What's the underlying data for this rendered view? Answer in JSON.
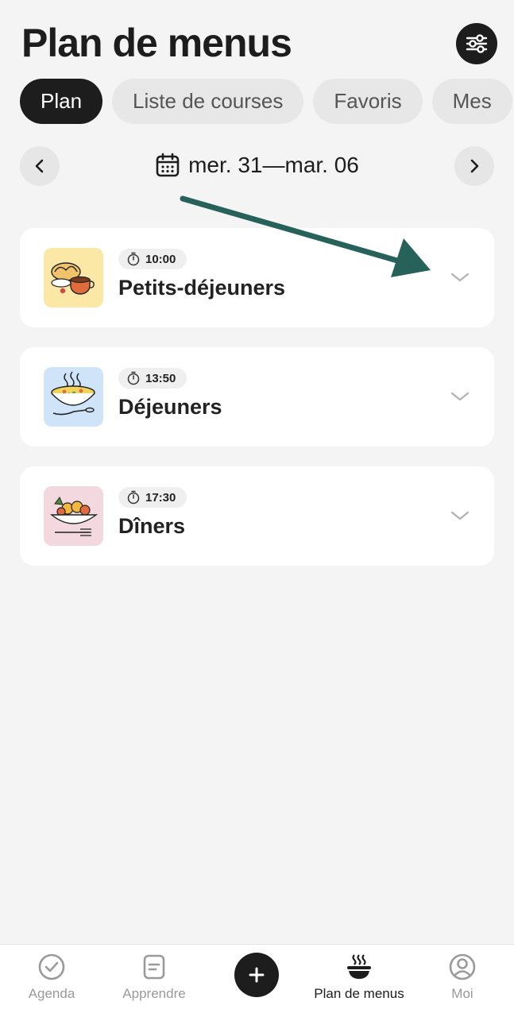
{
  "header": {
    "title": "Plan de menus",
    "filter_icon": "sliders-icon"
  },
  "tabs": [
    {
      "label": "Plan",
      "active": true
    },
    {
      "label": "Liste de courses",
      "active": false
    },
    {
      "label": "Favoris",
      "active": false
    },
    {
      "label": "Mes",
      "active": false
    }
  ],
  "week": {
    "label": "mer. 31—mar. 06",
    "icon": "calendar-icon",
    "prev_icon": "chevron-left-icon",
    "next_icon": "chevron-right-icon"
  },
  "meals": [
    {
      "time": "10:00",
      "title": "Petits-déjeuners",
      "thumb_color": "#fbe8a6",
      "icon": "breakfast-illustration"
    },
    {
      "time": "13:50",
      "title": "Déjeuners",
      "thumb_color": "#cfe3f9",
      "icon": "soup-bowl-illustration"
    },
    {
      "time": "17:30",
      "title": "Dîners",
      "thumb_color": "#f3d8e0",
      "icon": "dinner-plate-illustration"
    }
  ],
  "annotation": {
    "arrow_color": "#26625a"
  },
  "bottom_nav": {
    "items": [
      {
        "label": "Agenda",
        "icon": "check-circle-icon",
        "active": false
      },
      {
        "label": "Apprendre",
        "icon": "document-icon",
        "active": false
      },
      {
        "label": "Plan de menus",
        "icon": "steaming-bowl-icon",
        "active": true
      },
      {
        "label": "Moi",
        "icon": "user-circle-icon",
        "active": false
      }
    ],
    "add_icon": "plus-icon"
  },
  "colors": {
    "background": "#f4f4f4",
    "dark": "#1d1d1d",
    "muted": "#9a9a9a"
  }
}
